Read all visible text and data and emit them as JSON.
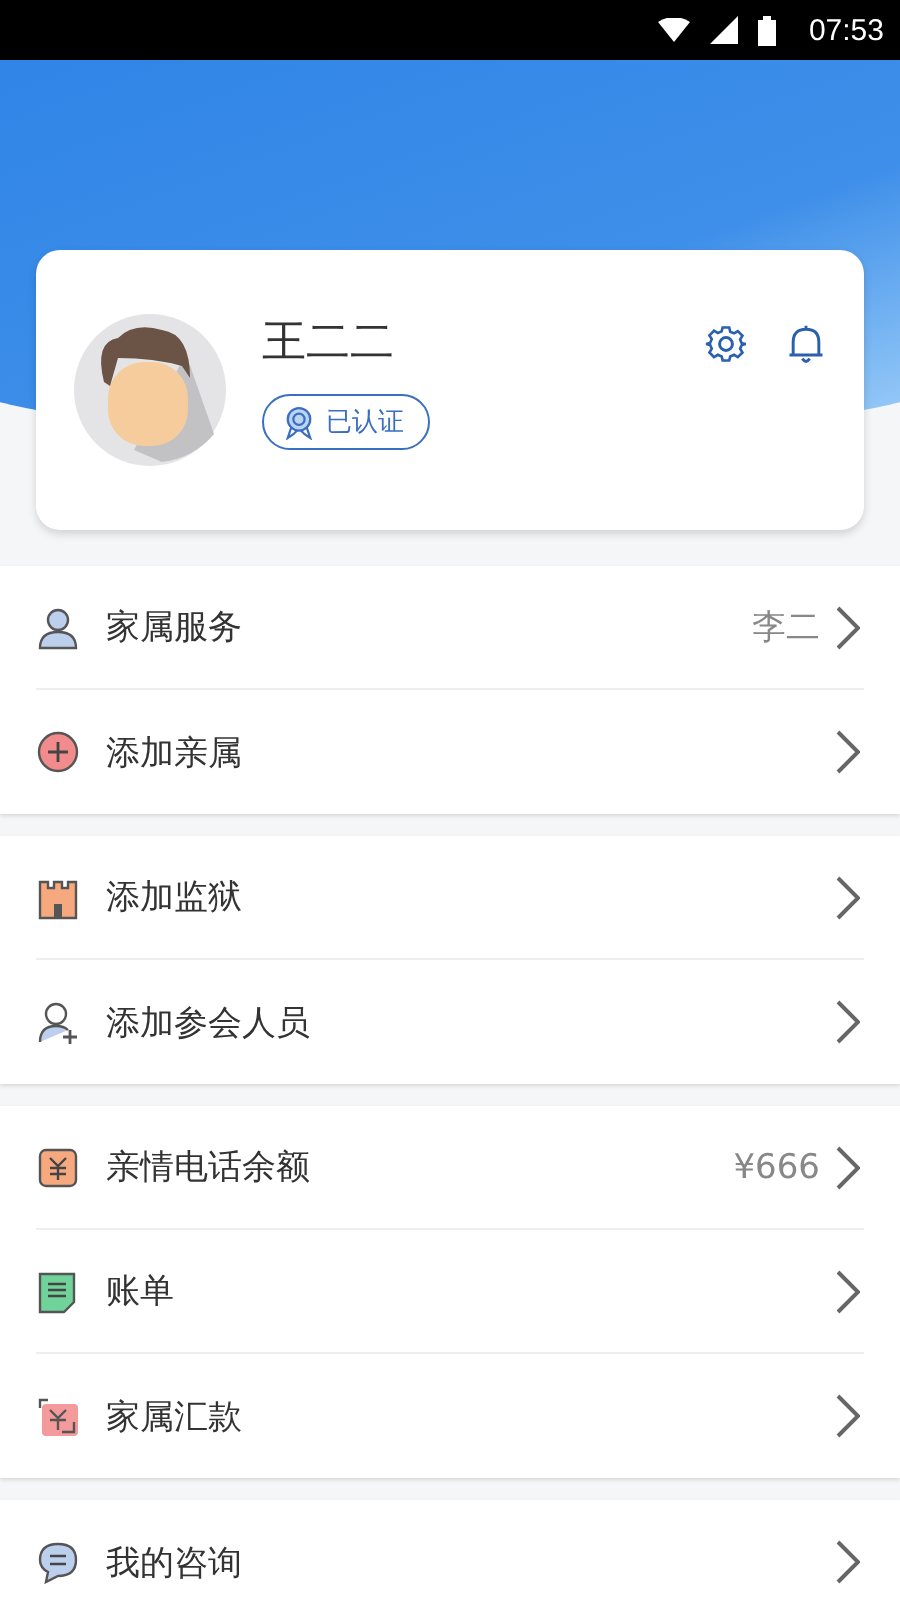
{
  "status_bar": {
    "time": "07:53"
  },
  "profile": {
    "name": "王二二",
    "badge": "已认证"
  },
  "sections": [
    {
      "items": [
        {
          "kind": "person",
          "label": "家属服务",
          "value": "李二"
        },
        {
          "kind": "plus",
          "label": "添加亲属"
        }
      ]
    },
    {
      "items": [
        {
          "kind": "castle",
          "label": "添加监狱"
        },
        {
          "kind": "person-add",
          "label": "添加参会人员"
        }
      ]
    },
    {
      "items": [
        {
          "kind": "coin",
          "label": "亲情电话余额",
          "value": "¥666"
        },
        {
          "kind": "bill",
          "label": "账单"
        },
        {
          "kind": "transfer",
          "label": "家属汇款"
        }
      ]
    },
    {
      "items": [
        {
          "kind": "chat",
          "label": "我的咨询"
        }
      ]
    }
  ]
}
